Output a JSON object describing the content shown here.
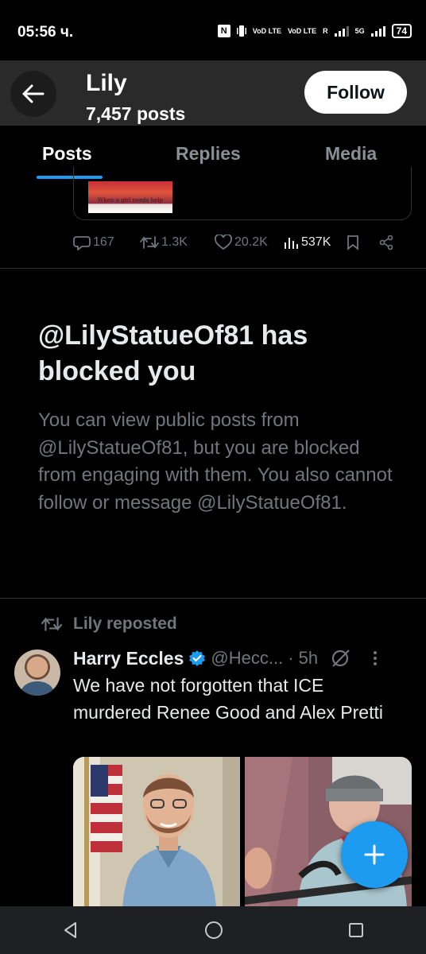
{
  "status_bar": {
    "time": "05:56 ч.",
    "nfc": "N",
    "volte": [
      "VoD LTE",
      "VoD LTE"
    ],
    "roaming": "R",
    "network": "5G",
    "battery": "74"
  },
  "header": {
    "back_icon": "arrow-left-icon",
    "name": "Lily",
    "post_count": "7,457 posts",
    "follow_label": "Follow"
  },
  "tabs": [
    {
      "label": "Posts",
      "active": true
    },
    {
      "label": "Replies",
      "active": false
    },
    {
      "label": "Media",
      "active": false
    }
  ],
  "previous_post": {
    "media_caption": "When a girl needs help",
    "actions": {
      "replies": "167",
      "reposts": "1.3K",
      "likes": "20.2K",
      "views": "537K"
    }
  },
  "blocked_notice": {
    "title": "@LilyStatueOf81 has blocked you",
    "body": "You can view public posts from @LilyStatueOf81, but you are blocked from engaging with them. You also cannot follow or message @LilyStatueOf81."
  },
  "repost": {
    "label": "Lily reposted",
    "author_name": "Harry Eccles",
    "handle": "@Hecc...",
    "time": "· 5h",
    "text": "We have not forgotten that ICE murdered Renee Good and Alex Pretti"
  },
  "colors": {
    "accent": "#1d9bf0",
    "muted": "#71767b",
    "background": "#000000"
  }
}
